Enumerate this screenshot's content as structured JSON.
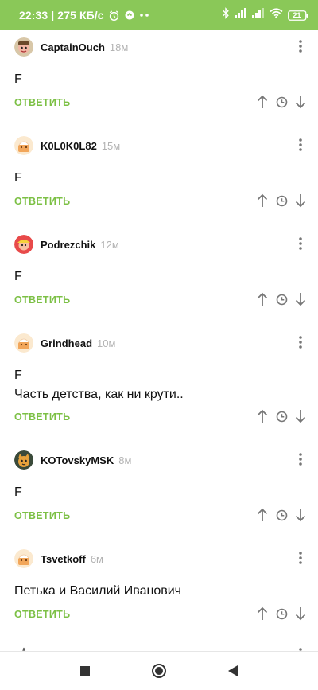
{
  "status_bar": {
    "time_speed": "22:33 | 275 КБ/с",
    "battery": "21"
  },
  "comments": [
    {
      "author": "CaptainOuch",
      "time": "18м",
      "text": "F",
      "reply_label": "ОТВЕТИТЬ",
      "avatar": "cartoon-avatar"
    },
    {
      "author": "K0L0K0L82",
      "time": "15м",
      "text": "F",
      "reply_label": "ОТВЕТИТЬ",
      "avatar": "default-avatar"
    },
    {
      "author": "Podrezchik",
      "time": "12м",
      "text": "F",
      "reply_label": "ОТВЕТИТЬ",
      "avatar": "red-avatar"
    },
    {
      "author": "Grindhead",
      "time": "10м",
      "text": "F\nЧасть детства, как ни крути..",
      "reply_label": "ОТВЕТИТЬ",
      "avatar": "default-avatar"
    },
    {
      "author": "KOTovskyMSK",
      "time": "8м",
      "text": "F",
      "reply_label": "ОТВЕТИТЬ",
      "avatar": "cat-avatar"
    },
    {
      "author": "Tsvetkoff",
      "time": "6м",
      "text": "Петька и Василий Иванович",
      "reply_label": "ОТВЕТИТЬ",
      "avatar": "default-avatar"
    }
  ],
  "colors": {
    "accent_green": "#8ac858",
    "reply_green": "#7cc045",
    "time_gray": "#b3b3b3",
    "icon_gray": "#7a7a7a"
  }
}
